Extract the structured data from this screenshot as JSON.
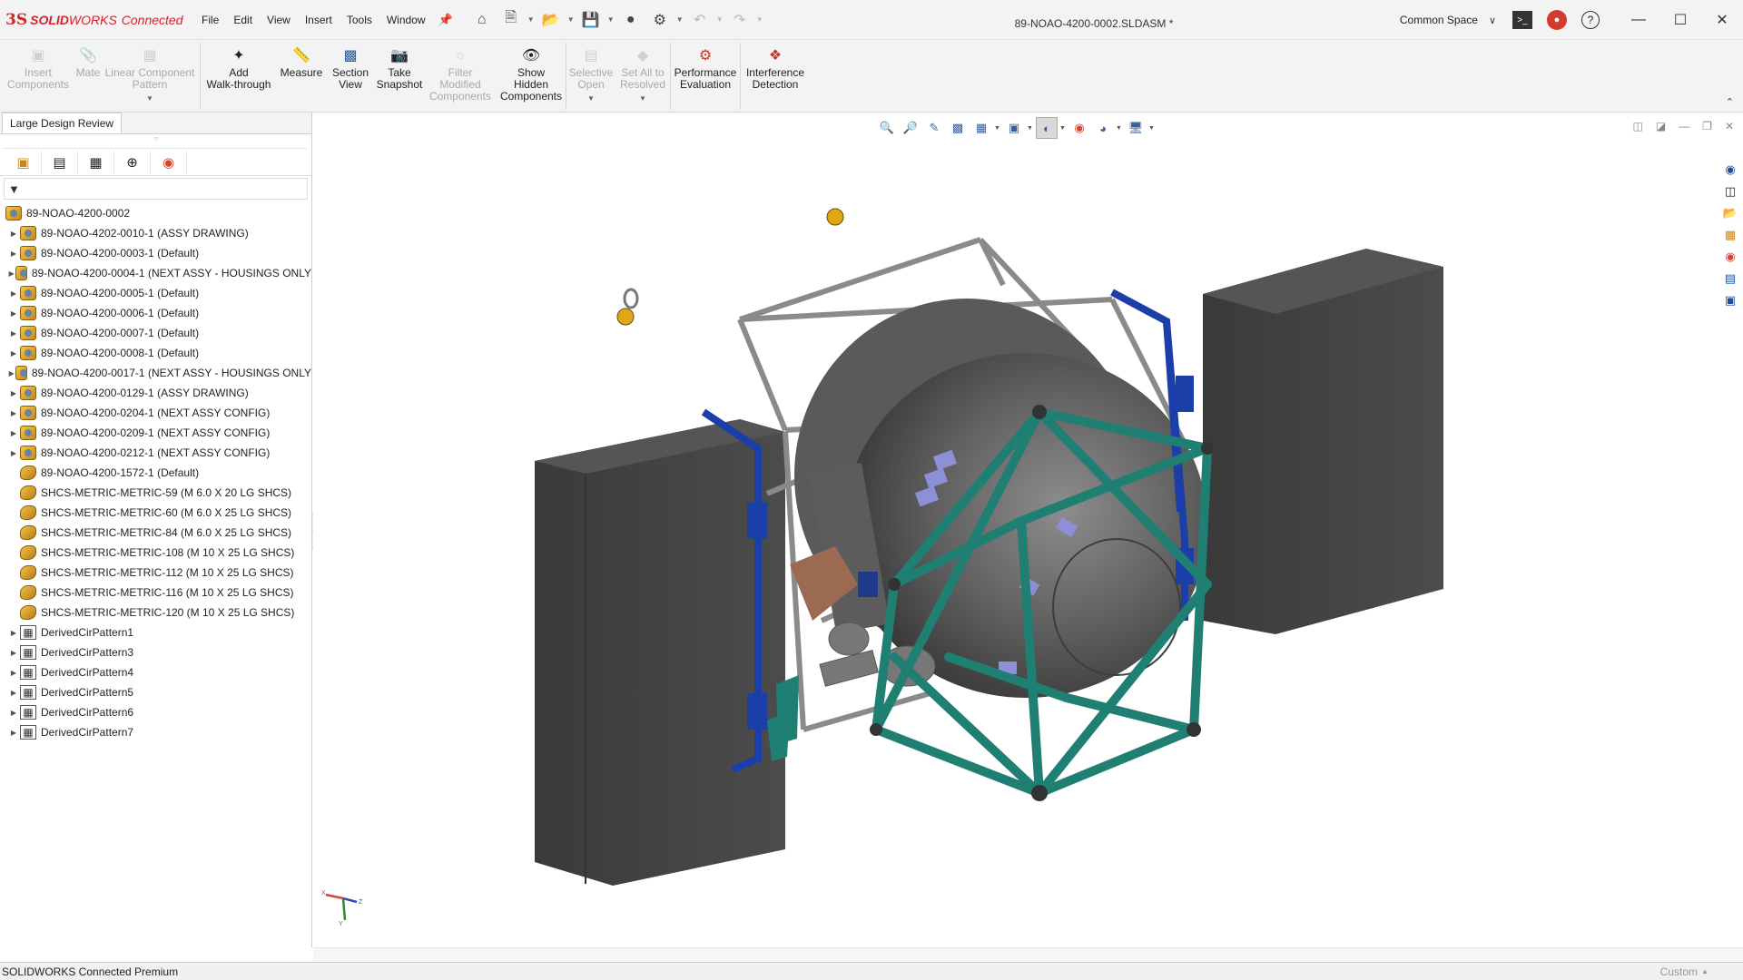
{
  "app": {
    "logo_ds": "3S",
    "logo_solid": "SOLID",
    "logo_works": "WORKS",
    "logo_connected": "Connected",
    "doc_title": "89-NOAO-4200-0002.SLDASM *",
    "workspace": "Common Space"
  },
  "menu": [
    "File",
    "Edit",
    "View",
    "Insert",
    "Tools",
    "Window"
  ],
  "ribbon": [
    {
      "label": "Insert\nComponents",
      "icon": "insert-components-icon",
      "disabled": true
    },
    {
      "label": "Mate",
      "icon": "mate-icon",
      "disabled": true
    },
    {
      "label": "Linear Component\nPattern",
      "icon": "linear-pattern-icon",
      "disabled": true,
      "arrow": true
    },
    {
      "label": "Add\nWalk-through",
      "icon": "walkthrough-icon",
      "disabled": false
    },
    {
      "label": "Measure",
      "icon": "measure-icon",
      "disabled": false
    },
    {
      "label": "Section\nView",
      "icon": "section-view-icon",
      "disabled": false
    },
    {
      "label": "Take\nSnapshot",
      "icon": "camera-icon",
      "disabled": false
    },
    {
      "label": "Filter\nModified\nComponents",
      "icon": "filter-modified-icon",
      "disabled": true
    },
    {
      "label": "Show\nHidden\nComponents",
      "icon": "show-hidden-icon",
      "disabled": false
    },
    {
      "label": "Selective\nOpen",
      "icon": "selective-open-icon",
      "disabled": true,
      "arrow": true
    },
    {
      "label": "Set All to\nResolved",
      "icon": "set-resolved-icon",
      "disabled": true,
      "arrow": true
    },
    {
      "label": "Performance\nEvaluation",
      "icon": "performance-icon",
      "disabled": false
    },
    {
      "label": "Interference\nDetection",
      "icon": "interference-icon",
      "disabled": false
    }
  ],
  "left_panel": {
    "tab_label": "Large Design Review",
    "root": "89-NOAO-4200-0002",
    "items": [
      {
        "label": "89-NOAO-4202-0010-1 (ASSY DRAWING)",
        "kind": "asm",
        "expandable": true
      },
      {
        "label": "89-NOAO-4200-0003-1 (Default)",
        "kind": "asm",
        "expandable": true
      },
      {
        "label": "89-NOAO-4200-0004-1 (NEXT ASSY - HOUSINGS ONLY",
        "kind": "asm",
        "expandable": true
      },
      {
        "label": "89-NOAO-4200-0005-1 (Default)",
        "kind": "asm",
        "expandable": true
      },
      {
        "label": "89-NOAO-4200-0006-1 (Default)",
        "kind": "asm",
        "expandable": true
      },
      {
        "label": "89-NOAO-4200-0007-1 (Default)",
        "kind": "asm",
        "expandable": true
      },
      {
        "label": "89-NOAO-4200-0008-1 (Default)",
        "kind": "asm",
        "expandable": true
      },
      {
        "label": "89-NOAO-4200-0017-1 (NEXT ASSY - HOUSINGS ONLY",
        "kind": "asm",
        "expandable": true
      },
      {
        "label": "89-NOAO-4200-0129-1 (ASSY DRAWING)",
        "kind": "asm",
        "expandable": true
      },
      {
        "label": "89-NOAO-4200-0204-1 (NEXT ASSY CONFIG)",
        "kind": "asm",
        "expandable": true
      },
      {
        "label": "89-NOAO-4200-0209-1 (NEXT ASSY CONFIG)",
        "kind": "asm",
        "expandable": true
      },
      {
        "label": "89-NOAO-4200-0212-1 (NEXT ASSY CONFIG)",
        "kind": "asm",
        "expandable": true
      },
      {
        "label": "89-NOAO-4200-1572-1 (Default)",
        "kind": "part",
        "expandable": false
      },
      {
        "label": "SHCS-METRIC-METRIC-59 (M 6.0 X 20 LG SHCS)",
        "kind": "part",
        "expandable": false
      },
      {
        "label": "SHCS-METRIC-METRIC-60 (M 6.0 X 25 LG SHCS)",
        "kind": "part",
        "expandable": false
      },
      {
        "label": "SHCS-METRIC-METRIC-84 (M 6.0 X 25 LG SHCS)",
        "kind": "part",
        "expandable": false
      },
      {
        "label": "SHCS-METRIC-METRIC-108 (M 10 X 25 LG SHCS)",
        "kind": "part",
        "expandable": false
      },
      {
        "label": "SHCS-METRIC-METRIC-112 (M 10 X 25 LG SHCS)",
        "kind": "part",
        "expandable": false
      },
      {
        "label": "SHCS-METRIC-METRIC-116 (M 10 X 25 LG SHCS)",
        "kind": "part",
        "expandable": false
      },
      {
        "label": "SHCS-METRIC-METRIC-120 (M 10 X 25 LG SHCS)",
        "kind": "part",
        "expandable": false
      },
      {
        "label": "DerivedCirPattern1",
        "kind": "pattern",
        "expandable": true
      },
      {
        "label": "DerivedCirPattern3",
        "kind": "pattern",
        "expandable": true
      },
      {
        "label": "DerivedCirPattern4",
        "kind": "pattern",
        "expandable": true
      },
      {
        "label": "DerivedCirPattern5",
        "kind": "pattern",
        "expandable": true
      },
      {
        "label": "DerivedCirPattern6",
        "kind": "pattern",
        "expandable": true
      },
      {
        "label": "DerivedCirPattern7",
        "kind": "pattern",
        "expandable": true
      }
    ]
  },
  "status": {
    "left": "SOLIDWORKS Connected Premium",
    "right": "Custom"
  },
  "colors": {
    "brand_red": "#d6222a",
    "frame_green": "#1f7f73",
    "frame_blue": "#1b3fa8",
    "housing_gray": "#4a4a4a"
  },
  "triad": {
    "x": "X",
    "y": "Y",
    "z": "Z"
  }
}
